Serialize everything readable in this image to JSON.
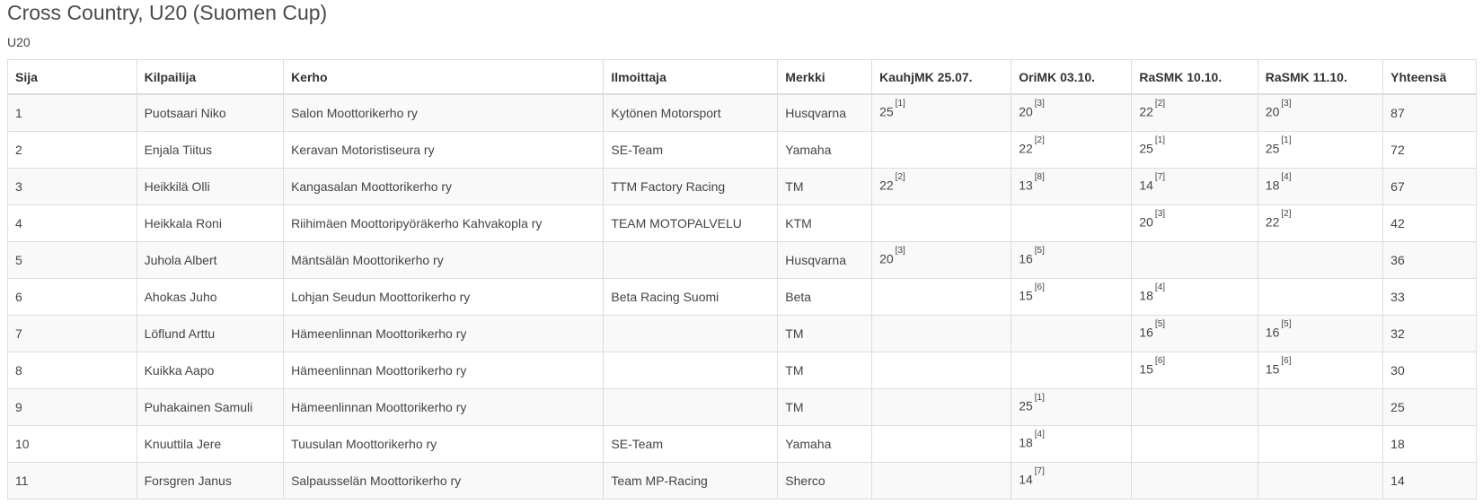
{
  "page": {
    "title": "Cross Country, U20 (Suomen Cup)",
    "subtitle": "U20"
  },
  "table": {
    "headers": [
      "Sija",
      "Kilpailija",
      "Kerho",
      "Ilmoittaja",
      "Merkki",
      "KauhjMK 25.07.",
      "OriMK 03.10.",
      "RaSMK 10.10.",
      "RaSMK 11.10.",
      "Yhteensä"
    ],
    "rows": [
      {
        "sija": "1",
        "kilpailija": "Puotsaari Niko",
        "kerho": "Salon Moottorikerho ry",
        "ilmoittaja": "Kytönen Motorsport",
        "merkki": "Husqvarna",
        "r1": {
          "pts": "25",
          "pos": "[1]"
        },
        "r2": {
          "pts": "20",
          "pos": "[3]"
        },
        "r3": {
          "pts": "22",
          "pos": "[2]"
        },
        "r4": {
          "pts": "20",
          "pos": "[3]"
        },
        "total": "87"
      },
      {
        "sija": "2",
        "kilpailija": "Enjala Tiitus",
        "kerho": "Keravan Motoristiseura ry",
        "ilmoittaja": "SE-Team",
        "merkki": "Yamaha",
        "r1": {
          "pts": "",
          "pos": ""
        },
        "r2": {
          "pts": "22",
          "pos": "[2]"
        },
        "r3": {
          "pts": "25",
          "pos": "[1]"
        },
        "r4": {
          "pts": "25",
          "pos": "[1]"
        },
        "total": "72"
      },
      {
        "sija": "3",
        "kilpailija": "Heikkilä Olli",
        "kerho": "Kangasalan Moottorikerho ry",
        "ilmoittaja": "TTM Factory Racing",
        "merkki": "TM",
        "r1": {
          "pts": "22",
          "pos": "[2]"
        },
        "r2": {
          "pts": "13",
          "pos": "[8]"
        },
        "r3": {
          "pts": "14",
          "pos": "[7]"
        },
        "r4": {
          "pts": "18",
          "pos": "[4]"
        },
        "total": "67"
      },
      {
        "sija": "4",
        "kilpailija": "Heikkala Roni",
        "kerho": "Riihimäen Moottoripyöräkerho Kahvakopla ry",
        "ilmoittaja": "TEAM MOTOPALVELU",
        "merkki": "KTM",
        "r1": {
          "pts": "",
          "pos": ""
        },
        "r2": {
          "pts": "",
          "pos": ""
        },
        "r3": {
          "pts": "20",
          "pos": "[3]"
        },
        "r4": {
          "pts": "22",
          "pos": "[2]"
        },
        "total": "42"
      },
      {
        "sija": "5",
        "kilpailija": "Juhola Albert",
        "kerho": "Mäntsälän Moottorikerho ry",
        "ilmoittaja": "",
        "merkki": "Husqvarna",
        "r1": {
          "pts": "20",
          "pos": "[3]"
        },
        "r2": {
          "pts": "16",
          "pos": "[5]"
        },
        "r3": {
          "pts": "",
          "pos": ""
        },
        "r4": {
          "pts": "",
          "pos": ""
        },
        "total": "36"
      },
      {
        "sija": "6",
        "kilpailija": "Ahokas Juho",
        "kerho": "Lohjan Seudun Moottorikerho ry",
        "ilmoittaja": "Beta Racing Suomi",
        "merkki": "Beta",
        "r1": {
          "pts": "",
          "pos": ""
        },
        "r2": {
          "pts": "15",
          "pos": "[6]"
        },
        "r3": {
          "pts": "18",
          "pos": "[4]"
        },
        "r4": {
          "pts": "",
          "pos": ""
        },
        "total": "33"
      },
      {
        "sija": "7",
        "kilpailija": "Löflund Arttu",
        "kerho": "Hämeenlinnan Moottorikerho ry",
        "ilmoittaja": "",
        "merkki": "TM",
        "r1": {
          "pts": "",
          "pos": ""
        },
        "r2": {
          "pts": "",
          "pos": ""
        },
        "r3": {
          "pts": "16",
          "pos": "[5]"
        },
        "r4": {
          "pts": "16",
          "pos": "[5]"
        },
        "total": "32"
      },
      {
        "sija": "8",
        "kilpailija": "Kuikka Aapo",
        "kerho": "Hämeenlinnan Moottorikerho ry",
        "ilmoittaja": "",
        "merkki": "TM",
        "r1": {
          "pts": "",
          "pos": ""
        },
        "r2": {
          "pts": "",
          "pos": ""
        },
        "r3": {
          "pts": "15",
          "pos": "[6]"
        },
        "r4": {
          "pts": "15",
          "pos": "[6]"
        },
        "total": "30"
      },
      {
        "sija": "9",
        "kilpailija": "Puhakainen Samuli",
        "kerho": "Hämeenlinnan Moottorikerho ry",
        "ilmoittaja": "",
        "merkki": "TM",
        "r1": {
          "pts": "",
          "pos": ""
        },
        "r2": {
          "pts": "25",
          "pos": "[1]"
        },
        "r3": {
          "pts": "",
          "pos": ""
        },
        "r4": {
          "pts": "",
          "pos": ""
        },
        "total": "25"
      },
      {
        "sija": "10",
        "kilpailija": "Knuuttila Jere",
        "kerho": "Tuusulan Moottorikerho ry",
        "ilmoittaja": "SE-Team",
        "merkki": "Yamaha",
        "r1": {
          "pts": "",
          "pos": ""
        },
        "r2": {
          "pts": "18",
          "pos": "[4]"
        },
        "r3": {
          "pts": "",
          "pos": ""
        },
        "r4": {
          "pts": "",
          "pos": ""
        },
        "total": "18"
      },
      {
        "sija": "11",
        "kilpailija": "Forsgren Janus",
        "kerho": "Salpausselän Moottorikerho ry",
        "ilmoittaja": "Team MP-Racing",
        "merkki": "Sherco",
        "r1": {
          "pts": "",
          "pos": ""
        },
        "r2": {
          "pts": "14",
          "pos": "[7]"
        },
        "r3": {
          "pts": "",
          "pos": ""
        },
        "r4": {
          "pts": "",
          "pos": ""
        },
        "total": "14"
      }
    ]
  }
}
